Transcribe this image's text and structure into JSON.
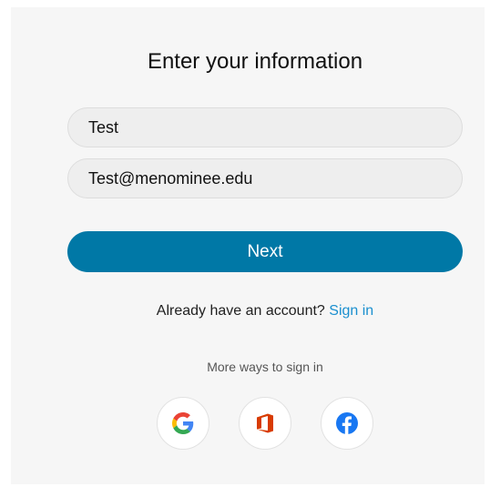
{
  "form": {
    "title": "Enter your information",
    "name_value": "Test",
    "email_value": "Test@menominee.edu",
    "next_label": "Next"
  },
  "account": {
    "prompt": "Already have an account?",
    "signin_label": "Sign in"
  },
  "social": {
    "heading": "More ways to sign in",
    "providers": [
      {
        "icon": "google-icon"
      },
      {
        "icon": "office-icon"
      },
      {
        "icon": "facebook-icon"
      }
    ]
  },
  "colors": {
    "primary": "#0078a6",
    "link": "#1a8fcf",
    "card_background": "#f6f6f6"
  }
}
